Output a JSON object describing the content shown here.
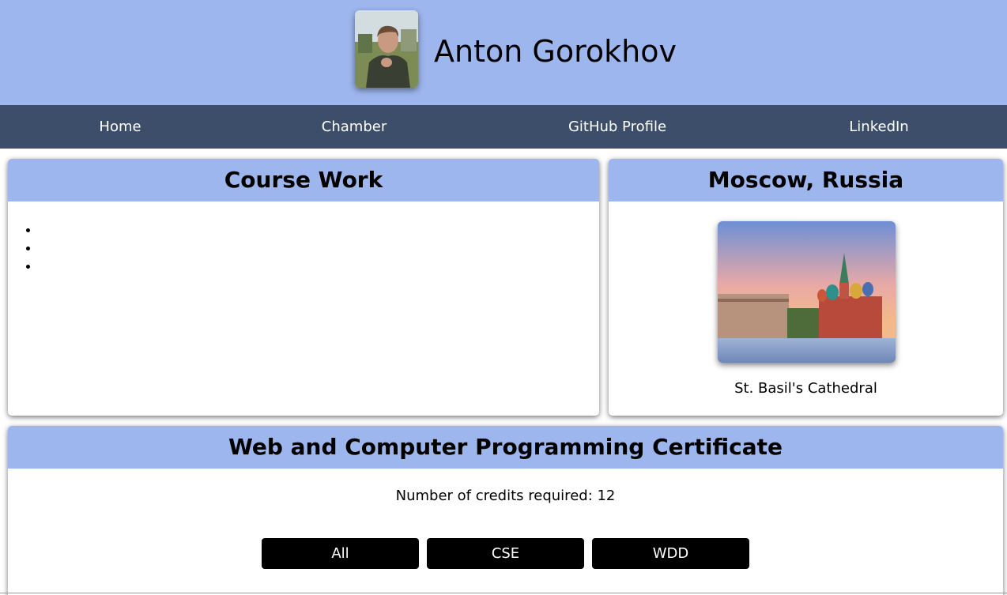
{
  "header": {
    "name": "Anton Gorokhov"
  },
  "nav": {
    "items": [
      "Home",
      "Chamber",
      "GitHub Profile",
      "LinkedIn"
    ]
  },
  "course_work": {
    "title": "Course Work",
    "items": [
      "",
      "",
      ""
    ]
  },
  "location": {
    "title": "Moscow, Russia",
    "caption": "St. Basil's Cathedral"
  },
  "certificate": {
    "title": "Web and Computer Programming Certificate",
    "credits_text": "Number of credits required: 12",
    "filters": [
      "All",
      "CSE",
      "WDD"
    ]
  },
  "colors": {
    "header_bg": "#9db6ee",
    "nav_bg": "#3d4e6b",
    "button_bg": "#000000"
  }
}
